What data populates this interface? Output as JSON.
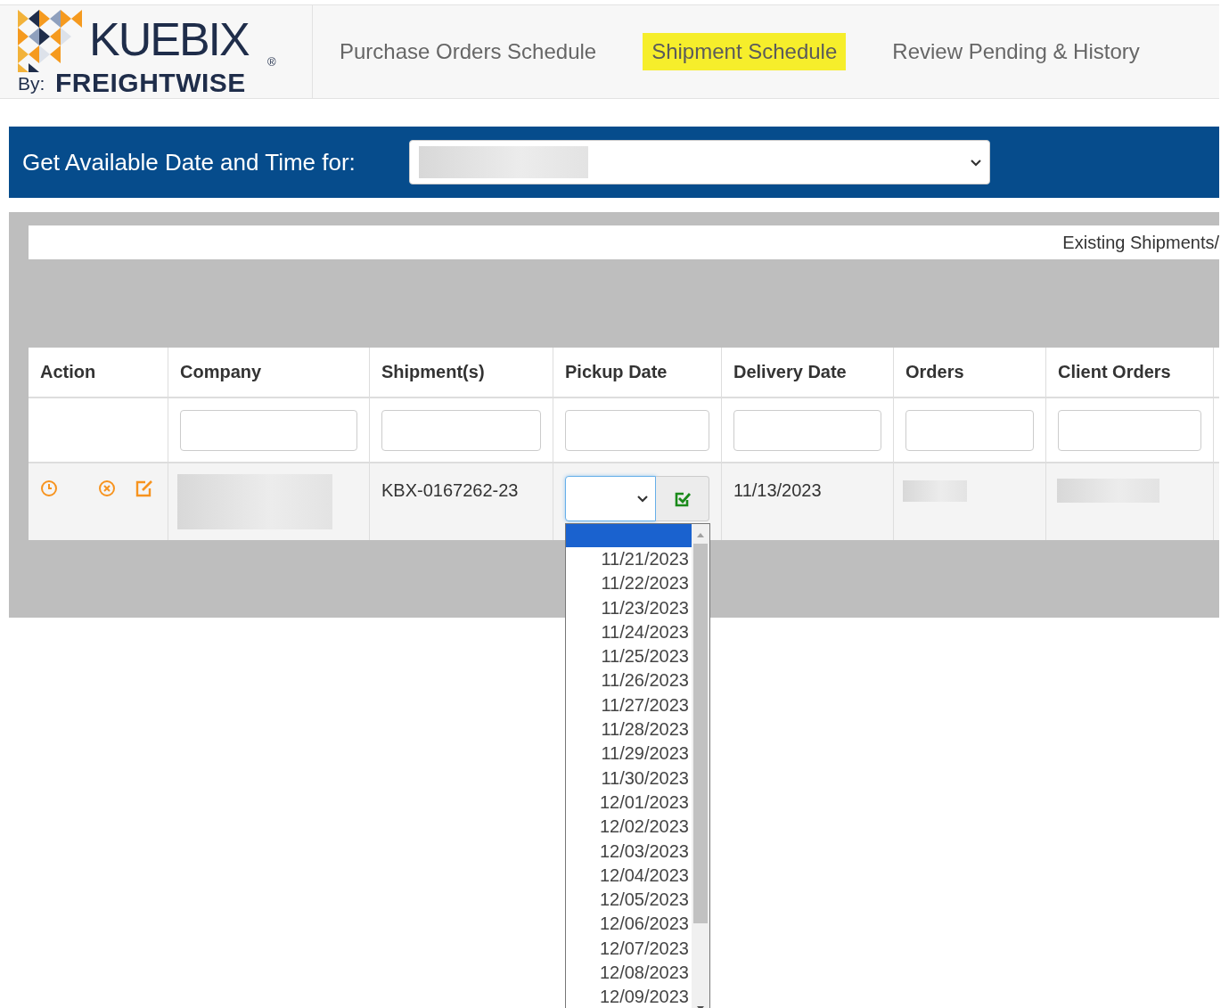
{
  "logo": {
    "name": "KUEBIX",
    "mark": "®",
    "by": "By:",
    "sub": "FREIGHTWISE"
  },
  "tabs": [
    {
      "label": "Purchase Orders Schedule",
      "selected": false
    },
    {
      "label": "Shipment Schedule",
      "selected": true
    },
    {
      "label": "Review Pending & History",
      "selected": false
    }
  ],
  "date_bar": {
    "label": "Get Available Date and Time for:"
  },
  "panel": {
    "notice": "Existing Shipments/"
  },
  "table": {
    "columns": [
      {
        "label": "Action",
        "filter": false
      },
      {
        "label": "Company",
        "filter": true
      },
      {
        "label": "Shipment(s)",
        "filter": true
      },
      {
        "label": "Pickup Date",
        "filter": true
      },
      {
        "label": "Delivery Date",
        "filter": true
      },
      {
        "label": "Orders",
        "filter": true
      },
      {
        "label": "Client Orders",
        "filter": true
      }
    ],
    "rows": [
      {
        "shipment": "KBX-0167262-23",
        "delivery_date": "11/13/2023",
        "pickup_dropdown": {
          "expanded": true,
          "blank_selected": true,
          "options": [
            {
              "label": "11/21/2023",
              "selected": false
            },
            {
              "label": "11/22/2023",
              "selected": false
            },
            {
              "label": "11/23/2023",
              "selected": false
            },
            {
              "label": "11/24/2023",
              "selected": false
            },
            {
              "label": "11/25/2023",
              "selected": false
            },
            {
              "label": "11/26/2023",
              "selected": false
            },
            {
              "label": "11/27/2023",
              "selected": false
            },
            {
              "label": "11/28/2023",
              "selected": false
            },
            {
              "label": "11/29/2023",
              "selected": false
            },
            {
              "label": "11/30/2023",
              "selected": false
            },
            {
              "label": "12/01/2023",
              "selected": false
            },
            {
              "label": "12/02/2023",
              "selected": false
            },
            {
              "label": "12/03/2023",
              "selected": false
            },
            {
              "label": "12/04/2023",
              "selected": false
            },
            {
              "label": "12/05/2023",
              "selected": false
            },
            {
              "label": "12/06/2023",
              "selected": false
            },
            {
              "label": "12/07/2023",
              "selected": false
            },
            {
              "label": "12/08/2023",
              "selected": false
            },
            {
              "label": "12/09/2023",
              "selected": false
            }
          ]
        }
      }
    ]
  }
}
